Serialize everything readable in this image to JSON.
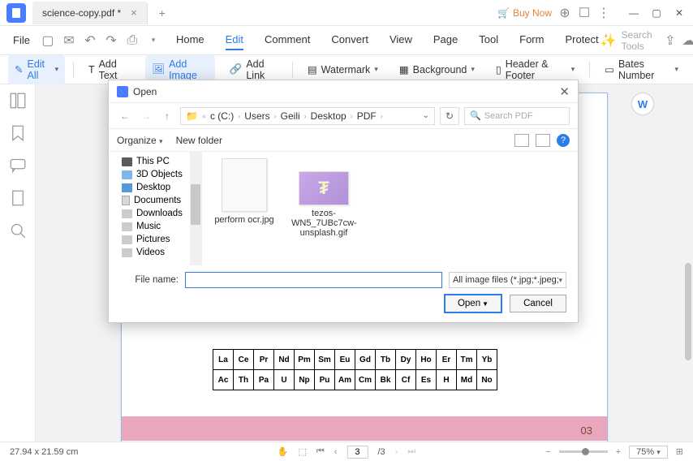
{
  "titlebar": {
    "filename": "science-copy.pdf *",
    "buy_now": "Buy Now"
  },
  "menubar": {
    "file": "File",
    "items": [
      "Home",
      "Edit",
      "Comment",
      "Convert",
      "View",
      "Page",
      "Tool",
      "Form",
      "Protect"
    ],
    "active_index": 1,
    "search_placeholder": "Search Tools"
  },
  "toolbar": {
    "edit_all": "Edit All",
    "add_text": "Add Text",
    "add_image": "Add Image",
    "add_link": "Add Link",
    "watermark": "Watermark",
    "background": "Background",
    "header_footer": "Header & Footer",
    "bates_number": "Bates Number"
  },
  "dialog": {
    "title": "Open",
    "breadcrumb": [
      "c (C:)",
      "Users",
      "Geili",
      "Desktop",
      "PDF"
    ],
    "search_placeholder": "Search PDF",
    "organize": "Organize",
    "new_folder": "New folder",
    "tree": [
      "This PC",
      "3D Objects",
      "Desktop",
      "Documents",
      "Downloads",
      "Music",
      "Pictures",
      "Videos"
    ],
    "files": [
      {
        "name": "perform ocr.jpg"
      },
      {
        "name": "tezos-WN5_7UBc7cw-unsplash.gif"
      }
    ],
    "filename_label": "File name:",
    "filename_value": "",
    "filetype": "All image files (*.jpg;*.jpeg;*.jpe",
    "open_btn": "Open",
    "cancel_btn": "Cancel"
  },
  "document": {
    "periodic_row1": [
      "La",
      "Ce",
      "Pr",
      "Nd",
      "Pm",
      "Sm",
      "Eu",
      "Gd",
      "Tb",
      "Dy",
      "Ho",
      "Er",
      "Tm",
      "Yb"
    ],
    "periodic_row2": [
      "Ac",
      "Th",
      "Pa",
      "U",
      "Np",
      "Pu",
      "Am",
      "Cm",
      "Bk",
      "Cf",
      "Es",
      "H",
      "Md",
      "No"
    ],
    "page_corner": "03"
  },
  "statusbar": {
    "dimensions": "27.94 x 21.59 cm",
    "current_page": "3",
    "total_pages": "/3",
    "zoom": "75%"
  }
}
